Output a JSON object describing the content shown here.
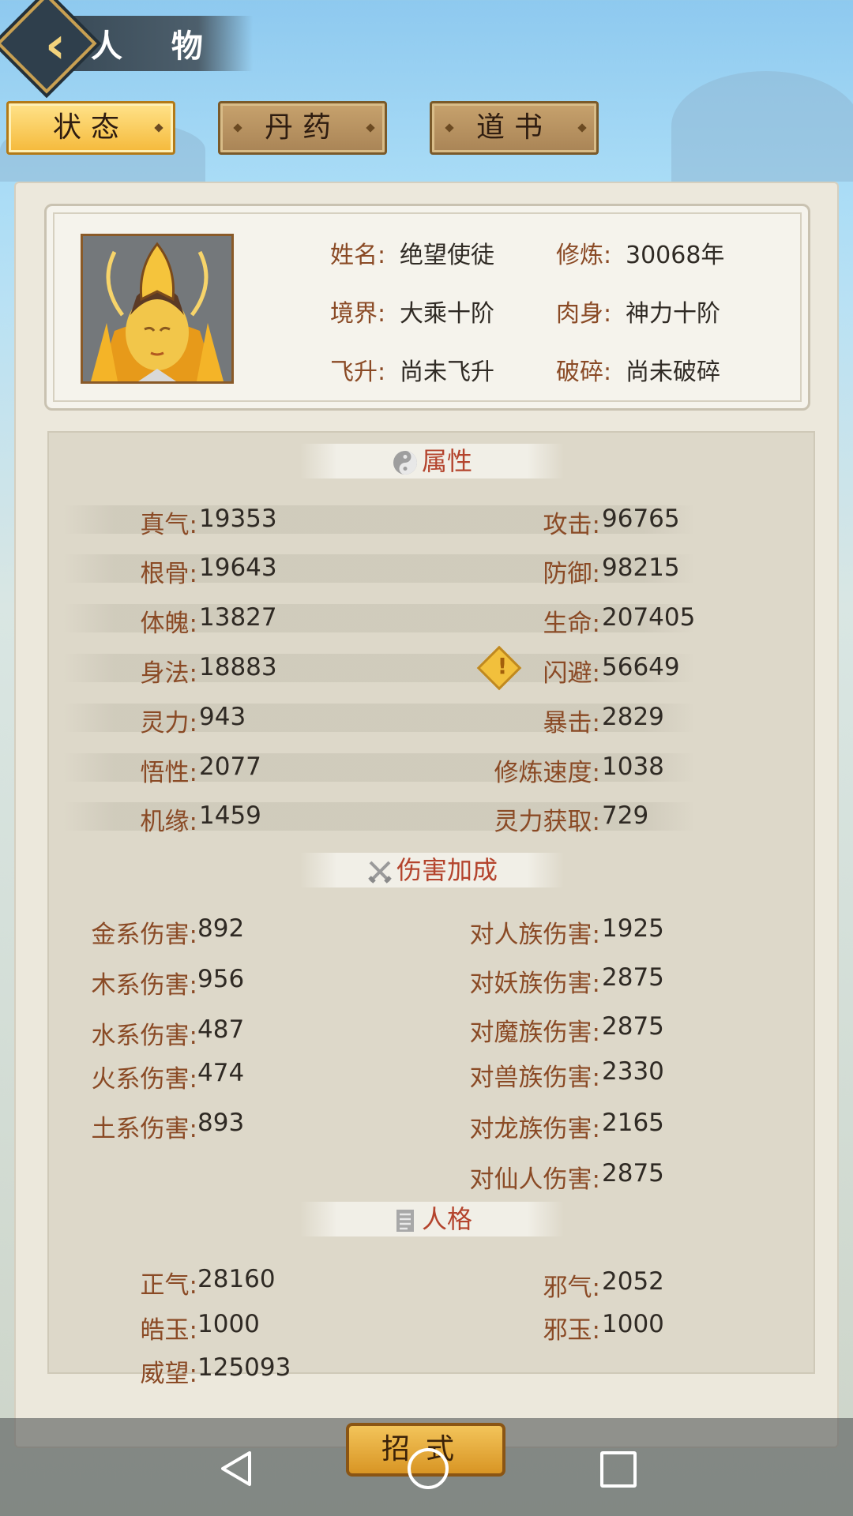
{
  "header": {
    "title": "人 物",
    "back_icon": "chevron-left-icon"
  },
  "tabs": [
    {
      "label": "状态",
      "active": true
    },
    {
      "label": "丹药",
      "active": false
    },
    {
      "label": "道书",
      "active": false
    }
  ],
  "profile": {
    "portrait_icon": "golden-helmet-avatar",
    "name_label": "姓名:",
    "name_value": "绝望使徒",
    "cultivation_label": "修炼:",
    "cultivation_value": "30068年",
    "realm_label": "境界:",
    "realm_value": "大乘十阶",
    "body_label": "肉身:",
    "body_value": "神力十阶",
    "ascend_label": "飞升:",
    "ascend_value": "尚未飞升",
    "shatter_label": "破碎:",
    "shatter_value": "尚未破碎"
  },
  "attributes": {
    "title": "属性",
    "left": [
      {
        "label": "真气:",
        "value": "19353"
      },
      {
        "label": "根骨:",
        "value": "19643"
      },
      {
        "label": "体魄:",
        "value": "13827"
      },
      {
        "label": "身法:",
        "value": "18883"
      },
      {
        "label": "灵力:",
        "value": "943"
      },
      {
        "label": "悟性:",
        "value": "2077"
      },
      {
        "label": "机缘:",
        "value": "1459"
      }
    ],
    "right": [
      {
        "label": "攻击:",
        "value": "96765"
      },
      {
        "label": "防御:",
        "value": "98215"
      },
      {
        "label": "生命:",
        "value": "207405"
      },
      {
        "label": "闪避:",
        "value": "56649"
      },
      {
        "label": "暴击:",
        "value": "2829"
      },
      {
        "label": "修炼速度:",
        "value": "1038"
      },
      {
        "label": "灵力获取:",
        "value": "729"
      }
    ]
  },
  "damage": {
    "title": "伤害加成",
    "left": [
      {
        "label": "金系伤害:",
        "value": "892"
      },
      {
        "label": "木系伤害:",
        "value": "956"
      },
      {
        "label": "水系伤害:",
        "value": "487"
      },
      {
        "label": "火系伤害:",
        "value": "474"
      },
      {
        "label": "土系伤害:",
        "value": "893"
      }
    ],
    "right": [
      {
        "label": "对人族伤害:",
        "value": "1925"
      },
      {
        "label": "对妖族伤害:",
        "value": "2875"
      },
      {
        "label": "对魔族伤害:",
        "value": "2875"
      },
      {
        "label": "对兽族伤害:",
        "value": "2330"
      },
      {
        "label": "对龙族伤害:",
        "value": "2165"
      },
      {
        "label": "对仙人伤害:",
        "value": "2875"
      }
    ]
  },
  "personality": {
    "title": "人格",
    "left": [
      {
        "label": "正气:",
        "value": "28160"
      },
      {
        "label": "皓玉:",
        "value": "1000"
      },
      {
        "label": "威望:",
        "value": "125093"
      }
    ],
    "right": [
      {
        "label": "邪气:",
        "value": "2052"
      },
      {
        "label": "邪玉:",
        "value": "1000"
      }
    ]
  },
  "bottom": {
    "skill_button": "招式"
  },
  "colors": {
    "label": "#8a4a25",
    "section_title": "#b4442d",
    "active_tab": "#f5b93a"
  }
}
